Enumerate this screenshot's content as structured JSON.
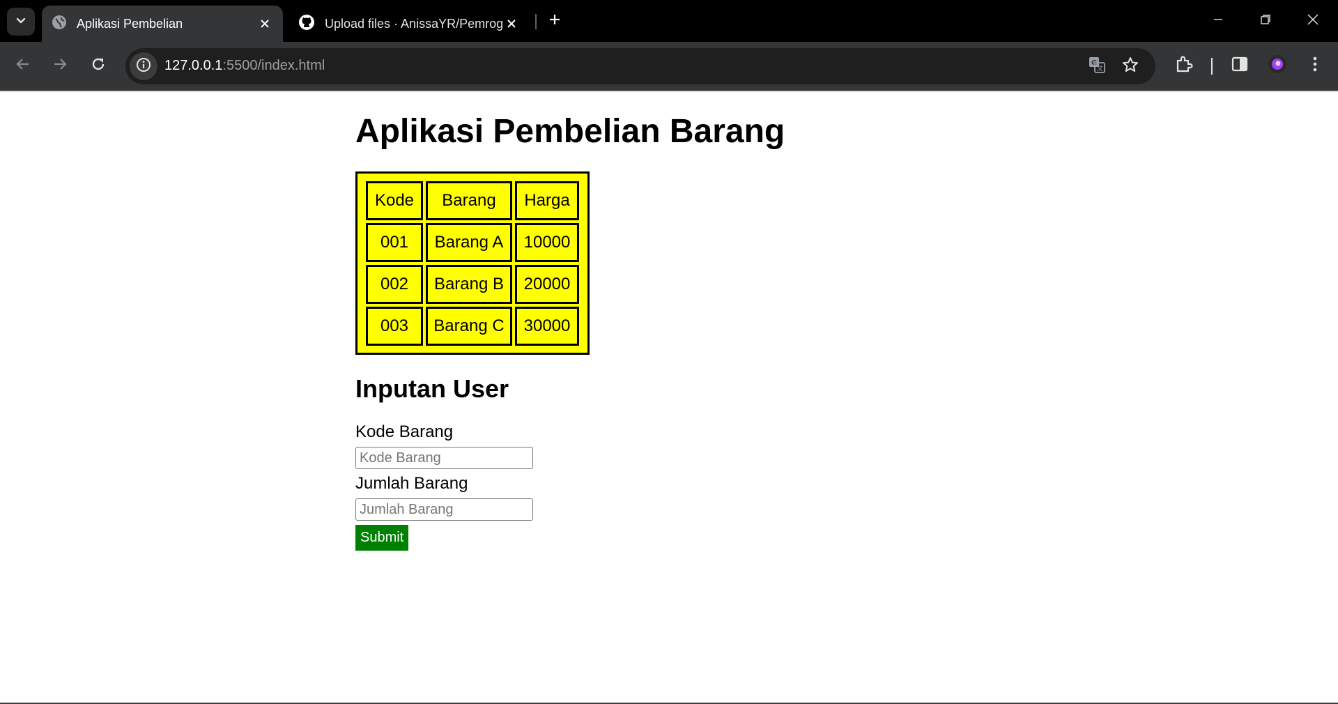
{
  "browser": {
    "tabs": [
      {
        "title": "Aplikasi Pembelian",
        "icon": "globe-icon",
        "active": true
      },
      {
        "title": "Upload files · AnissaYR/Pemrog",
        "icon": "github-icon",
        "active": false
      }
    ],
    "address_bar": {
      "host": "127.0.0.1",
      "rest": ":5500/index.html"
    }
  },
  "page": {
    "title": "Aplikasi Pembelian Barang",
    "table": {
      "headers": [
        "Kode",
        "Barang",
        "Harga"
      ],
      "rows": [
        [
          "001",
          "Barang A",
          "10000"
        ],
        [
          "002",
          "Barang B",
          "20000"
        ],
        [
          "003",
          "Barang C",
          "30000"
        ]
      ],
      "background_color": "#ffff00"
    },
    "form": {
      "section_title": "Inputan User",
      "kode_label": "Kode Barang",
      "kode_placeholder": "Kode Barang",
      "jumlah_label": "Jumlah Barang",
      "jumlah_placeholder": "Jumlah Barang",
      "submit_label": "Submit",
      "submit_color": "#008000"
    }
  }
}
